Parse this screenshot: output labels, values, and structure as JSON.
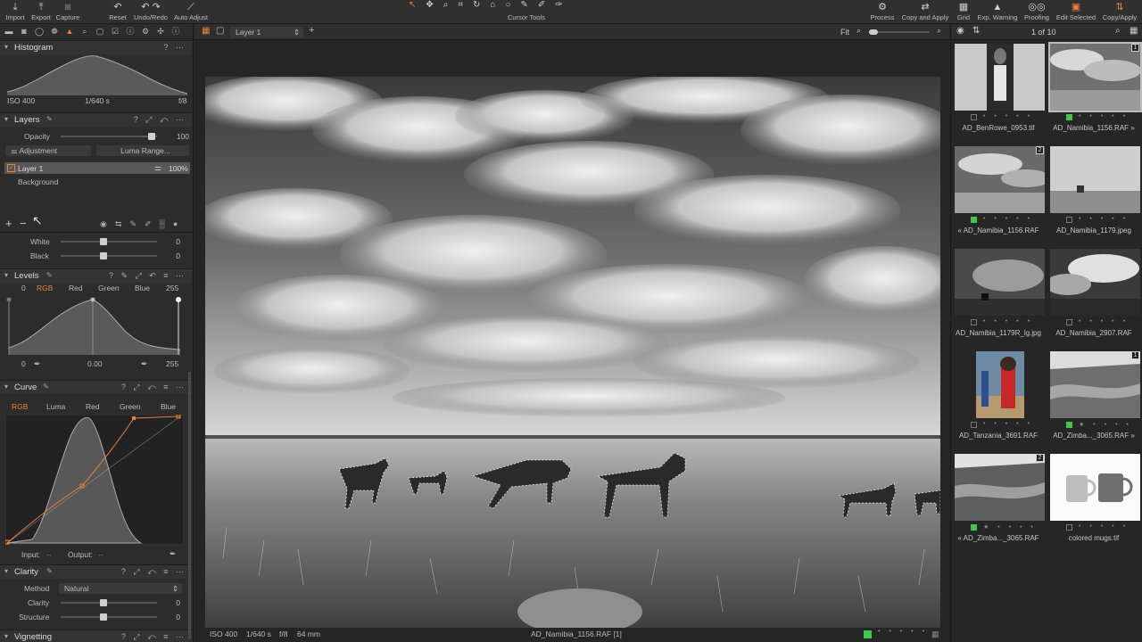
{
  "toolbar": {
    "left": [
      {
        "label": "Import",
        "icon": "import-icon"
      },
      {
        "label": "Export",
        "icon": "export-icon"
      },
      {
        "label": "Capture",
        "icon": "capture-icon"
      },
      {
        "label": "Reset",
        "icon": "reset-icon"
      },
      {
        "label": "Undo/Redo",
        "icon": "undo-redo-icon"
      },
      {
        "label": "Auto Adjust",
        "icon": "auto-adjust-icon"
      }
    ],
    "cursor_tools_label": "Cursor Tools",
    "right": [
      {
        "label": "Process",
        "icon": "process-icon"
      },
      {
        "label": "Copy and Apply",
        "icon": "copy-apply-icon"
      },
      {
        "label": "Grid",
        "icon": "grid-icon"
      },
      {
        "label": "Exp. Warning",
        "icon": "exposure-warning-icon"
      },
      {
        "label": "Proofing",
        "icon": "proofing-icon"
      },
      {
        "label": "Edit Selected",
        "icon": "edit-selected-icon"
      },
      {
        "label": "Copy/Apply",
        "icon": "copy-apply-icon"
      }
    ]
  },
  "histogram": {
    "title": "Histogram",
    "iso": "ISO 400",
    "shutter": "1/640 s",
    "aperture": "f/8"
  },
  "layers": {
    "title": "Layers",
    "opacity_label": "Opacity",
    "opacity_value": "100",
    "adjustment_label": "Adjustment",
    "luma_range_label": "Luma Range...",
    "layer1_name": "Layer 1",
    "layer1_opacity": "100%",
    "background_name": "Background",
    "add_symbol": "+",
    "remove_symbol": "−"
  },
  "white_black": {
    "white_label": "White",
    "white_value": "0",
    "black_label": "Black",
    "black_value": "0"
  },
  "levels": {
    "title": "Levels",
    "left_value": "0",
    "right_value": "255",
    "channels": [
      "RGB",
      "Red",
      "Green",
      "Blue"
    ],
    "bottom_left": "0",
    "bottom_mid": "0.00",
    "bottom_right": "255"
  },
  "curve": {
    "title": "Curve",
    "channels": [
      "RGB",
      "Luma",
      "Red",
      "Green",
      "Blue"
    ],
    "input_label": "Input:",
    "input_value": "--",
    "output_label": "Output:",
    "output_value": "--"
  },
  "clarity": {
    "title": "Clarity",
    "method_label": "Method",
    "method_value": "Natural",
    "clarity_label": "Clarity",
    "clarity_value": "0",
    "structure_label": "Structure",
    "structure_value": "0"
  },
  "vignetting": {
    "title": "Vignetting"
  },
  "viewer": {
    "layer_select": "Layer 1",
    "fit_label": "Fit",
    "status_iso": "ISO 400",
    "status_shutter": "1/640 s",
    "status_aperture": "f/8",
    "status_focal": "64 mm",
    "status_filename": "AD_Namibia_1156.RAF [1]"
  },
  "browser": {
    "count": "1 of 10",
    "items": [
      {
        "name": "AD_BenRowe_0953.tif",
        "badge": "",
        "green": false
      },
      {
        "name": "AD_Namibia_1156.RAF",
        "badge": "1",
        "green": true,
        "prefix": "",
        "suffix": "»"
      },
      {
        "name": "AD_Namibia_1156.RAF",
        "badge": "2",
        "green": true,
        "prefix": "«",
        "suffix": ""
      },
      {
        "name": "AD_Namibia_1179.jpeg",
        "badge": "",
        "green": false
      },
      {
        "name": "AD_Namibia_1179R_lg.jpg",
        "badge": "",
        "green": false
      },
      {
        "name": "AD_Namibia_2907.RAF",
        "badge": "",
        "green": false
      },
      {
        "name": "AD_Tanzania_3691.RAF",
        "badge": "",
        "green": false
      },
      {
        "name": "AD_Zimba..._3065.RAF",
        "badge": "1",
        "green": true,
        "prefix": "",
        "suffix": "»"
      },
      {
        "name": "AD_Zimba..._3065.RAF",
        "badge": "2",
        "green": true,
        "prefix": "«",
        "suffix": ""
      },
      {
        "name": "colored mugs.tif",
        "badge": "",
        "green": false
      }
    ]
  }
}
